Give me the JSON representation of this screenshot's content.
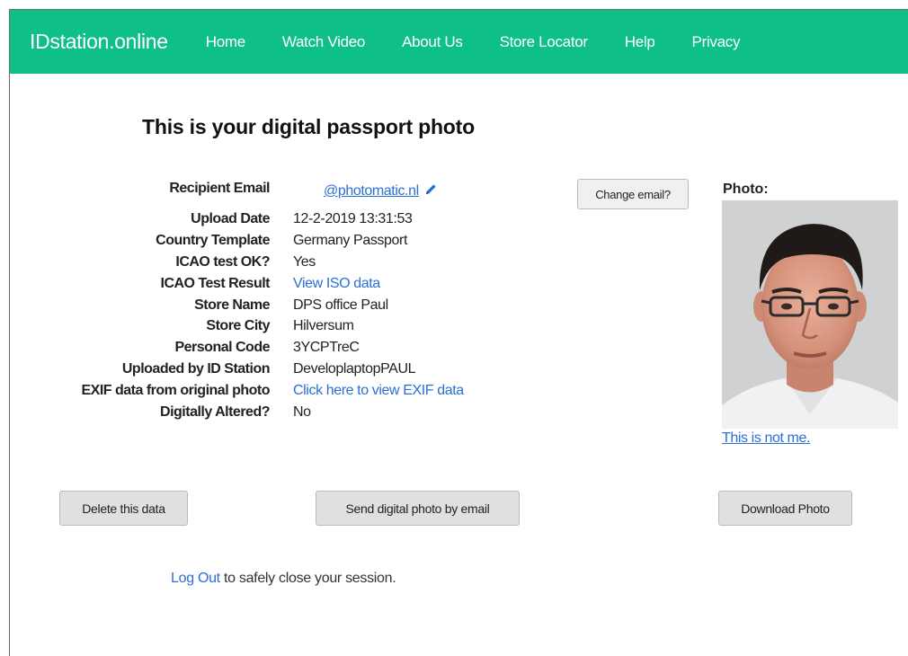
{
  "nav": {
    "brand": "IDstation.online",
    "links": [
      "Home",
      "Watch Video",
      "About Us",
      "Store Locator",
      "Help",
      "Privacy"
    ]
  },
  "page_title": "This is your digital passport photo",
  "details": {
    "email_label": "Recipient Email",
    "email_value": "@photomatic.nl",
    "upload_date_label": "Upload Date",
    "upload_date_value": "12-2-2019 13:31:53",
    "country_label": "Country Template",
    "country_value": "Germany Passport",
    "icao_ok_label": "ICAO test OK?",
    "icao_ok_value": "Yes",
    "icao_result_label": "ICAO Test Result",
    "icao_result_value": "View ISO data",
    "store_name_label": "Store Name",
    "store_name_value": "DPS office Paul",
    "store_city_label": "Store City",
    "store_city_value": "Hilversum",
    "personal_code_label": "Personal Code",
    "personal_code_value": "3YCPTreC",
    "uploaded_by_label": "Uploaded by ID Station",
    "uploaded_by_value": "DeveloplaptopPAUL",
    "exif_label": "EXIF data from original photo",
    "exif_value": "Click here to view EXIF data",
    "altered_label": "Digitally Altered?",
    "altered_value": "No"
  },
  "buttons": {
    "change_email": "Change email?",
    "delete": "Delete this data",
    "send_email": "Send digital photo by email",
    "download": "Download Photo"
  },
  "photo": {
    "label": "Photo:",
    "not_me": "This is not me."
  },
  "footer": {
    "logout_link": "Log Out",
    "logout_text": " to safely close your session."
  },
  "colors": {
    "navbar": "#0fbf8a",
    "link": "#2a6fd6",
    "button_bg": "#e0e0e0"
  }
}
